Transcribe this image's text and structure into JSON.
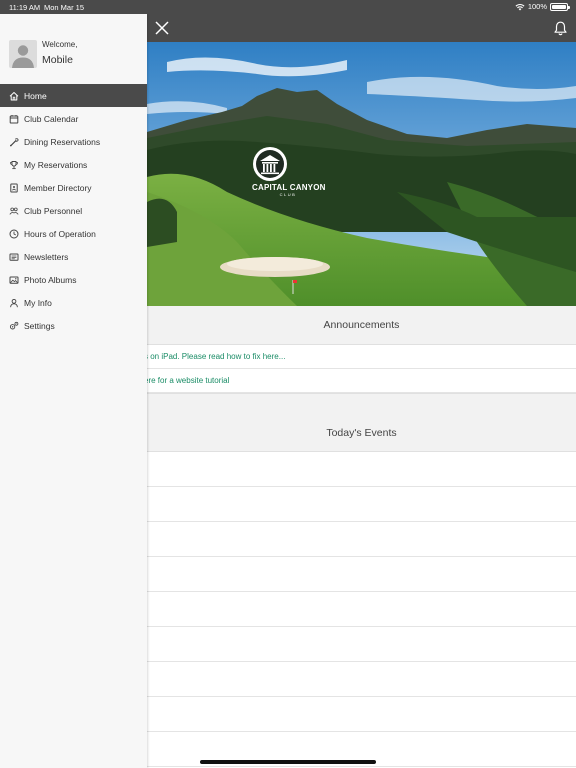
{
  "status_bar": {
    "time": "11:19 AM",
    "date": "Mon Mar 15",
    "battery": "100%"
  },
  "hero": {
    "club_name": "CAPITAL CANYON",
    "club_sub": "CLUB"
  },
  "announcements": {
    "title": "Announcements",
    "items": [
      {
        "text": "s on iPad. Please read how to fix here..."
      },
      {
        "text": "ere for a website tutorial"
      }
    ]
  },
  "events": {
    "title": "Today's Events",
    "row_count": 9
  },
  "sidebar": {
    "welcome": "Welcome,",
    "user_name": "Mobile",
    "items": [
      {
        "label": "Home",
        "icon": "home-icon",
        "active": true
      },
      {
        "label": "Club Calendar",
        "icon": "calendar-icon"
      },
      {
        "label": "Dining Reservations",
        "icon": "utensils-icon"
      },
      {
        "label": "My Reservations",
        "icon": "trophy-icon"
      },
      {
        "label": "Member Directory",
        "icon": "directory-icon"
      },
      {
        "label": "Club Personnel",
        "icon": "people-icon"
      },
      {
        "label": "Hours of Operation",
        "icon": "clock-icon"
      },
      {
        "label": "Newsletters",
        "icon": "newspaper-icon"
      },
      {
        "label": "Photo Albums",
        "icon": "photo-icon"
      },
      {
        "label": "My Info",
        "icon": "user-icon"
      },
      {
        "label": "Settings",
        "icon": "gears-icon"
      }
    ]
  },
  "colors": {
    "toolbar": "#4a4a4a",
    "link": "#1a8c66",
    "sidebar_bg": "#f7f7f7"
  }
}
